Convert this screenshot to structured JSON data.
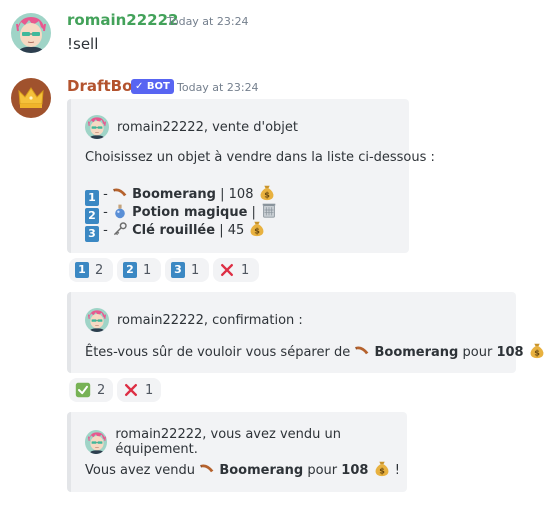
{
  "colors": {
    "user_name": "#43a25a",
    "bot_name": "#b3532e",
    "bot_badge": "#5865f2",
    "number_key": "#3b88c3"
  },
  "message1": {
    "username": "romain22222",
    "timestamp": "Today at 23:24",
    "text": "!sell"
  },
  "message2": {
    "username": "DraftBot",
    "badge": "BOT",
    "timestamp": "Today at 23:24"
  },
  "embed1": {
    "author": "romain22222, vente d'objet",
    "intro": "Choisissez un objet à vendre dans la liste ci-dessous :",
    "items": [
      {
        "num": "1",
        "icon": "boomerang-icon",
        "name": "Boomerang",
        "price": "108",
        "price_icon": "money-bag-icon"
      },
      {
        "num": "2",
        "icon": "potion-icon",
        "name": "Potion magique",
        "price": "",
        "price_icon": "wastebasket-icon"
      },
      {
        "num": "3",
        "icon": "old-key-icon",
        "name": "Clé rouillée",
        "price": "45",
        "price_icon": "money-bag-icon"
      }
    ]
  },
  "reactions1": [
    {
      "emoji": "1",
      "count": "2"
    },
    {
      "emoji": "2",
      "count": "1"
    },
    {
      "emoji": "3",
      "count": "1"
    },
    {
      "emoji": "x",
      "count": "1"
    }
  ],
  "embed2": {
    "author": "romain22222, confirmation :",
    "text_before": "Êtes-vous sûr de vouloir vous séparer de",
    "item": "Boomerang",
    "text_mid": "pour",
    "price": "108",
    "text_end": "?"
  },
  "reactions2": [
    {
      "emoji": "check",
      "count": "2"
    },
    {
      "emoji": "x",
      "count": "1"
    }
  ],
  "embed3": {
    "author": "romain22222, vous avez vendu un équipement.",
    "text_before": "Vous avez vendu",
    "item": "Boomerang",
    "text_mid": "pour",
    "price": "108",
    "text_end": "!"
  }
}
